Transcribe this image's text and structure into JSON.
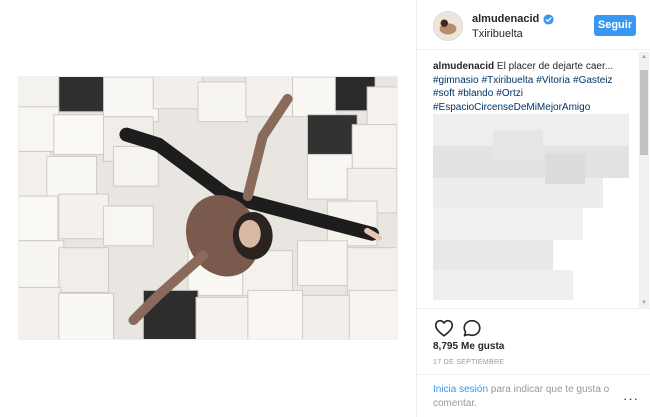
{
  "post": {
    "username": "almudenacid",
    "location": "Txiribuelta",
    "follow_label": "Seguir",
    "caption_text": "El placer de dejarte caer...",
    "hashtags": [
      "#gimnasio",
      "#Txiribuelta",
      "#Vitoria",
      "#Gasteiz",
      "#soft",
      "#blando",
      "#Ortzi",
      "#EspacioCircenseDeMiMejorAmigo"
    ],
    "likes_count": "8,795",
    "likes_label": "Me gusta",
    "date": "17 de septiembre",
    "login_link": "Inicia sesión",
    "login_rest": " para indicar que te gusta o comentar.",
    "more_label": "···"
  },
  "icons": {
    "like": "heart-outline-icon",
    "comment": "comment-bubble-icon",
    "verified": "verified-badge-icon",
    "more": "more-dots-icon"
  },
  "colors": {
    "accent": "#3897f0",
    "hashtag": "#003569",
    "muted": "#999999",
    "text": "#262626"
  }
}
